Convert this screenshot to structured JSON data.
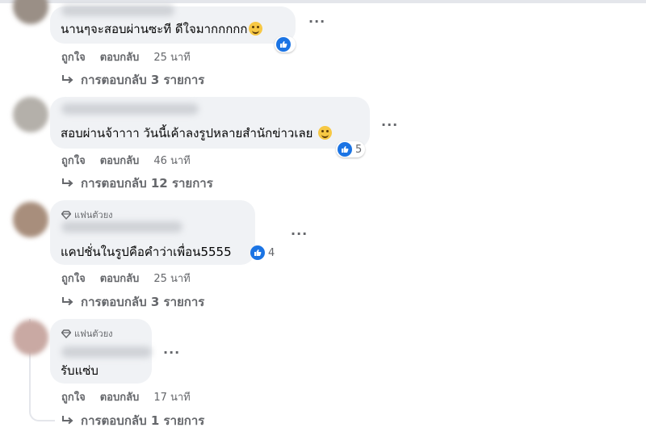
{
  "labels": {
    "like": "ถูกใจ",
    "reply": "ตอบกลับ",
    "more": "···"
  },
  "colors": {
    "like_blue": "#1b74e4",
    "secondary_text": "#65676b",
    "bubble_bg": "#f0f2f5"
  },
  "comments": [
    {
      "text": "นานๆจะสอบผ่านซะที ดีใจมากกกกก",
      "emoji": "laughing-emoji",
      "reaction_icon": "like-icon",
      "reaction_count": "",
      "time": "25 นาที",
      "replies": "การตอบกลับ 3 รายการ"
    },
    {
      "text": "สอบผ่านจ้าาาา วันนี้เค้าลงรูปหลายสำนักข่าวเลย",
      "emoji": "smile-emoji",
      "reaction_icon": "like-icon",
      "reaction_count": "5",
      "time": "46 นาที",
      "replies": "การตอบกลับ 12 รายการ"
    },
    {
      "badge": "แฟนตัวยง",
      "badge_icon": "diamond-icon",
      "text": "แคปชั่นในรูปคือคำว่าเพื่อน5555",
      "reaction_icon": "like-icon",
      "reaction_count": "4",
      "time": "25 นาที",
      "replies": "การตอบกลับ 3 รายการ"
    },
    {
      "badge": "แฟนตัวยง",
      "badge_icon": "diamond-icon",
      "text": "รับแซ่บ",
      "time": "17 นาที",
      "replies": "การตอบกลับ 1 รายการ"
    }
  ]
}
